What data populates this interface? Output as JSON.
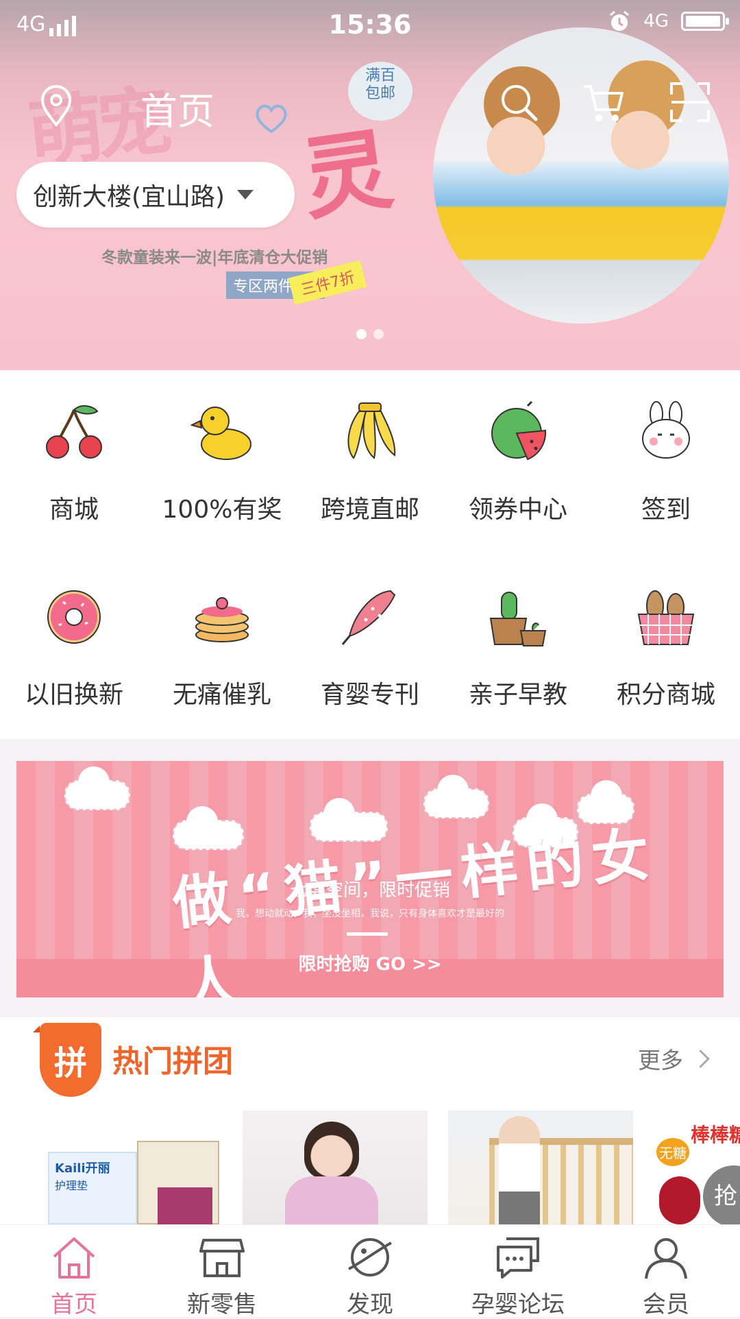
{
  "status_bar": {
    "network_left": "4G",
    "time": "15:36",
    "network_right": "4G"
  },
  "header": {
    "title": "首页",
    "location": "创新大楼(宜山路)",
    "free_ship_badge": "满百\n包邮",
    "promo_line": "冬款童装来一波|年底清仓大促销",
    "promo_tag_1": "专区两件8折",
    "promo_tag_2": "三件7折"
  },
  "categories": [
    {
      "label": "商城",
      "icon": "cherry-icon"
    },
    {
      "label": "100%有奖",
      "icon": "duck-icon"
    },
    {
      "label": "跨境直邮",
      "icon": "banana-icon"
    },
    {
      "label": "领券中心",
      "icon": "watermelon-icon"
    },
    {
      "label": "签到",
      "icon": "bunny-icon"
    },
    {
      "label": "以旧换新",
      "icon": "donut-icon"
    },
    {
      "label": "无痛催乳",
      "icon": "pancake-icon"
    },
    {
      "label": "育婴专刊",
      "icon": "umbrella-icon"
    },
    {
      "label": "亲子早教",
      "icon": "cactus-icon"
    },
    {
      "label": "积分商城",
      "icon": "bread-basket-icon"
    }
  ],
  "banner": {
    "title": "做“猫”一样的女人",
    "subtitle": "七度空间，限时促销",
    "small_text": "我，想动就动，我，坐没坐相，我说，只有身体喜欢才是最好的",
    "cta": "限时抢购 GO >>"
  },
  "group_buy": {
    "badge": "拼",
    "title": "热门拼团",
    "more": "更多",
    "products": [
      {
        "brand": "Kaili开丽",
        "caption": "护理垫"
      },
      {
        "caption": ""
      },
      {
        "caption": ""
      },
      {
        "tag": "无糖",
        "caption": "棒棒糖",
        "action": "抢"
      }
    ]
  },
  "nav": [
    {
      "label": "首页",
      "icon": "home-icon",
      "active": true
    },
    {
      "label": "新零售",
      "icon": "store-icon",
      "active": false
    },
    {
      "label": "发现",
      "icon": "planet-icon",
      "active": false
    },
    {
      "label": "孕婴论坛",
      "icon": "chat-icon",
      "active": false
    },
    {
      "label": "会员",
      "icon": "user-icon",
      "active": false
    }
  ],
  "colors": {
    "accent_pink": "#e6749a",
    "group_orange": "#f0652b",
    "hero_bg": "#f8c2cc"
  }
}
